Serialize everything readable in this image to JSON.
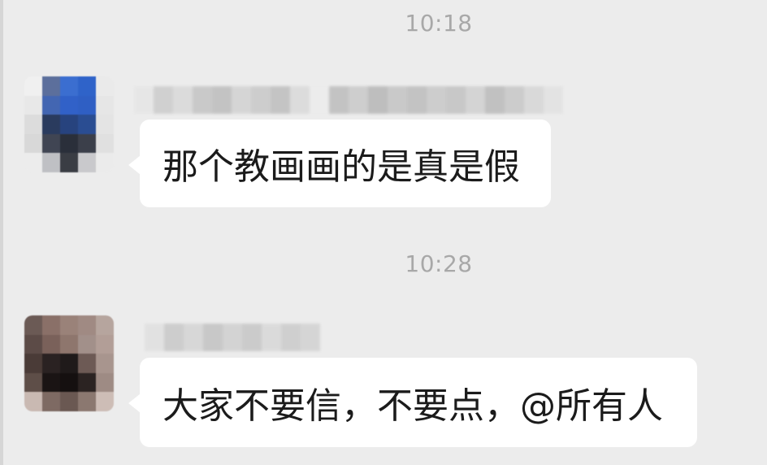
{
  "chat": {
    "messages": [
      {
        "time": "10:18",
        "text": "那个教画画的是真是假",
        "avatar_colors": [
          "#f0f0f0",
          "#5c6f9c",
          "#3b6ed0",
          "#2f63c9",
          "#eaeaea",
          "#e8e8e8",
          "#4366b2",
          "#3161c8",
          "#2f5fc4",
          "#e6e6e6",
          "#dcdcdc",
          "#2a3b5e",
          "#27437e",
          "#2a4d92",
          "#e4e4e4",
          "#d8d8d8",
          "#404553",
          "#2a2f3a",
          "#3b3f4a",
          "#e0e0e0",
          "#ececec",
          "#bfc0c4",
          "#3a3d44",
          "#c9c9cc",
          "#ebebeb"
        ],
        "name_colors": [
          "#e6e6e6",
          "#cccccc",
          "#d9d9d9",
          "#c4c4c4",
          "#bdbdbd",
          "#d2d2d2",
          "#c8c8c8",
          "#bebebe",
          "#dadada",
          "#ececec",
          "#bdbdbd",
          "#c9c9c9",
          "#b6b6b6",
          "#c4c4c4",
          "#bcbcbc",
          "#c8c8c8",
          "#c2c2c2",
          "#d0d0d0",
          "#bababa",
          "#c7c7c7",
          "#d6d6d6",
          "#e2e2e2"
        ]
      },
      {
        "time": "10:28",
        "text": "大家不要信，不要点，@所有人",
        "avatar_colors": [
          "#6b5a55",
          "#8a7068",
          "#9a8279",
          "#a08a83",
          "#b6a59e",
          "#5c4b47",
          "#7a615a",
          "#8e766d",
          "#a2908a",
          "#b29e97",
          "#4a3b37",
          "#2a2222",
          "#1f1a1a",
          "#6d5a55",
          "#a8958e",
          "#5e4e48",
          "#1a1414",
          "#151010",
          "#2b2322",
          "#9e8b84",
          "#c9b9b2",
          "#7e6a63",
          "#6a5852",
          "#8b7870",
          "#cdbdb6"
        ],
        "name_colors": [
          "#e0e0e0",
          "#c8c8c8",
          "#d4d4d4",
          "#c2c2c2",
          "#cfcfcf",
          "#c6c6c6",
          "#d8d8d8",
          "#cbcbcb",
          "#d2d2d2"
        ]
      }
    ]
  }
}
